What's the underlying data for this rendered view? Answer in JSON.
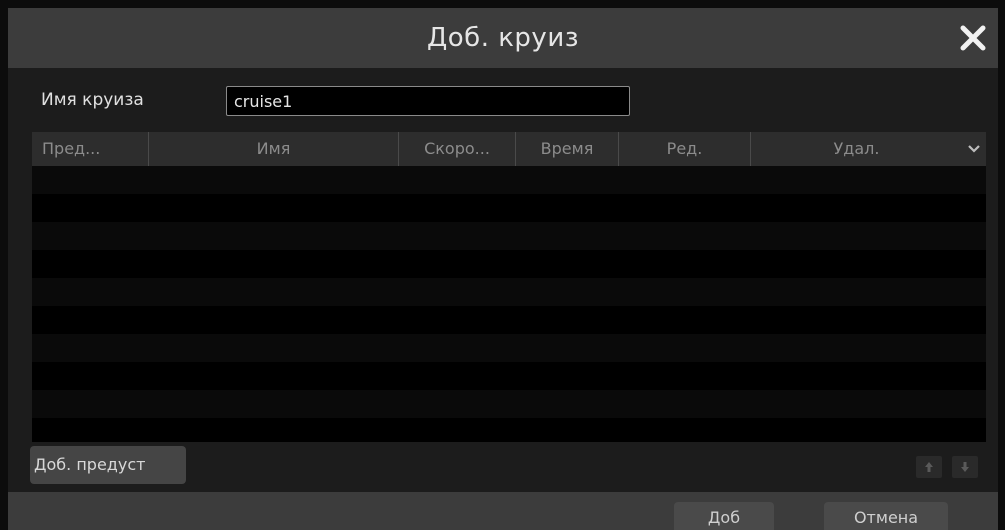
{
  "dialog": {
    "title": "Доб. круиз",
    "close_icon": "close-icon"
  },
  "form": {
    "name_label": "Имя круиза",
    "name_value": "cruise1"
  },
  "table": {
    "columns": [
      "Пред...",
      "Имя",
      "Скоро...",
      "Время",
      "Ред.",
      "Удал."
    ],
    "menu_icon": "chevron-down-icon",
    "rows": []
  },
  "actions": {
    "add_preset_label": "Доб. предуст",
    "move_up_icon": "arrow-up-icon",
    "move_down_icon": "arrow-down-icon",
    "add_label": "Доб",
    "cancel_label": "Отмена"
  },
  "colors": {
    "titlebar": "#3c3c3c",
    "panel": "#1c1c1c",
    "table_bg": "#000000",
    "header_text": "#8c8c8c"
  }
}
